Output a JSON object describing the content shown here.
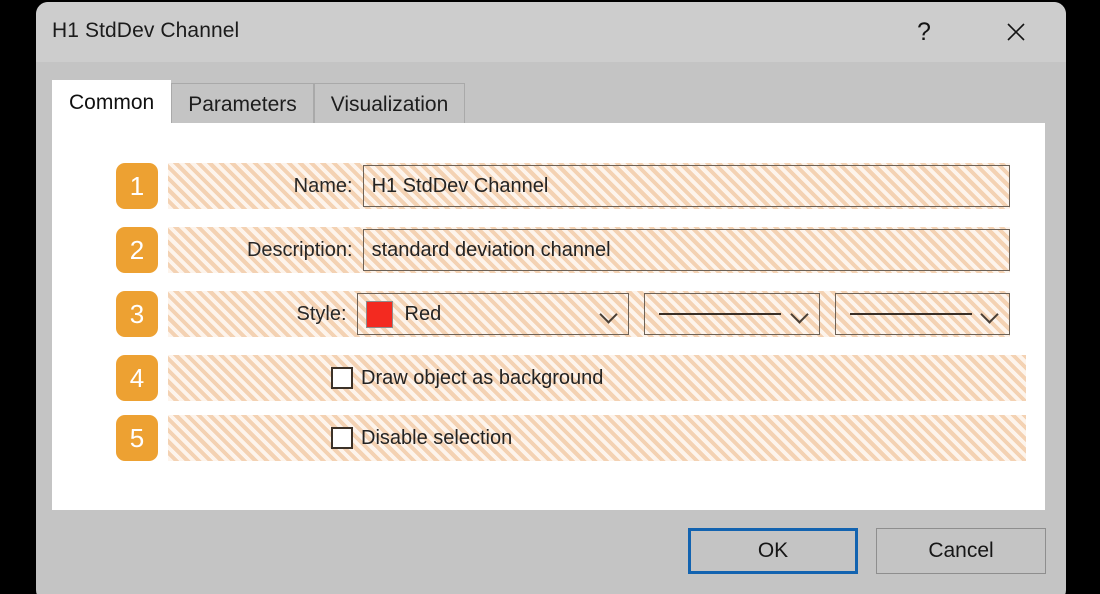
{
  "window": {
    "title": "H1 StdDev Channel",
    "help_icon": "question-mark-icon",
    "close_icon": "close-icon"
  },
  "tabs": [
    {
      "label": "Common",
      "active": true
    },
    {
      "label": "Parameters",
      "active": false
    },
    {
      "label": "Visualization",
      "active": false
    }
  ],
  "form": {
    "rows": [
      {
        "badge": "1",
        "label": "Name:",
        "value": "H1 StdDev Channel"
      },
      {
        "badge": "2",
        "label": "Description:",
        "value": "standard deviation channel"
      },
      {
        "badge": "3",
        "label": "Style:",
        "color_name": "Red",
        "color_hex": "#f32a20",
        "line_style_1": "solid",
        "line_style_2": "solid"
      },
      {
        "badge": "4",
        "label": "Draw object as background",
        "checked": false
      },
      {
        "badge": "5",
        "label": "Disable selection",
        "checked": false
      }
    ]
  },
  "footer": {
    "ok_label": "OK",
    "cancel_label": "Cancel"
  },
  "colors": {
    "badge": "#eda132",
    "focus_border": "#1263b0",
    "swatch_red": "#f32a20",
    "hatch_base": "#fae2cd",
    "window_chrome": "#c4c4c4",
    "titlebar": "#cdcdcd"
  }
}
